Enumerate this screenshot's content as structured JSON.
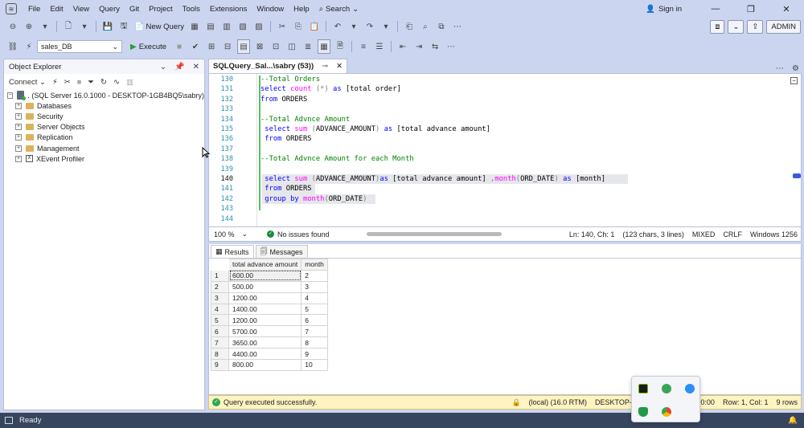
{
  "menubar": {
    "items": [
      "File",
      "Edit",
      "View",
      "Query",
      "Git",
      "Project",
      "Tools",
      "Extensions",
      "Window",
      "Help"
    ],
    "search_label": "Search",
    "signin_label": "Sign in"
  },
  "toolbar": {
    "new_query_label": "New Query",
    "admin_label": "ADMIN",
    "database": "sales_DB",
    "execute_label": "Execute"
  },
  "object_explorer": {
    "title": "Object Explorer",
    "connect_label": "Connect",
    "server_node": ". (SQL Server 16.0.1000 - DESKTOP-1GB4BQ5\\sabry)",
    "nodes": [
      "Databases",
      "Security",
      "Server Objects",
      "Replication",
      "Management",
      "XEvent Profiler"
    ]
  },
  "editor": {
    "tab_title": "SQLQuery_Sal...\\sabry (53))",
    "line_numbers": [
      "130",
      "131",
      "132",
      "133",
      "134",
      "135",
      "136",
      "137",
      "138",
      "139",
      "140",
      "141",
      "142",
      "143",
      "144"
    ],
    "current_line": "140",
    "lines": {
      "l130": "--Total Orders",
      "l134": "--Total Advnce Amount",
      "l138": "--Total Advnce Amount for each Month"
    },
    "status": {
      "zoom": "100 %",
      "issues": "No issues found",
      "position": "Ln: 140, Ch: 1",
      "selection": "(123 chars, 3 lines)",
      "indent": "MIXED",
      "eol": "CRLF",
      "encoding": "Windows 1256"
    }
  },
  "results": {
    "tabs": [
      "Results",
      "Messages"
    ],
    "columns": [
      "total advance amount",
      "month"
    ],
    "rows": [
      [
        "1",
        "600.00",
        "2"
      ],
      [
        "2",
        "500.00",
        "3"
      ],
      [
        "3",
        "1200.00",
        "4"
      ],
      [
        "4",
        "1400.00",
        "5"
      ],
      [
        "5",
        "1200.00",
        "6"
      ],
      [
        "6",
        "5700.00",
        "7"
      ],
      [
        "7",
        "3650.00",
        "8"
      ],
      [
        "8",
        "4400.00",
        "9"
      ],
      [
        "9",
        "800.00",
        "10"
      ]
    ]
  },
  "query_status": {
    "message": "Query executed successfully.",
    "server": "(local) (16.0 RTM)",
    "host": "DESKTOP-1GB4BQ5\\sab",
    "time": "00:00:00",
    "rowcol": "Row: 1, Col: 1",
    "rows": "9 rows"
  },
  "statusbar": {
    "ready_label": "Ready"
  }
}
